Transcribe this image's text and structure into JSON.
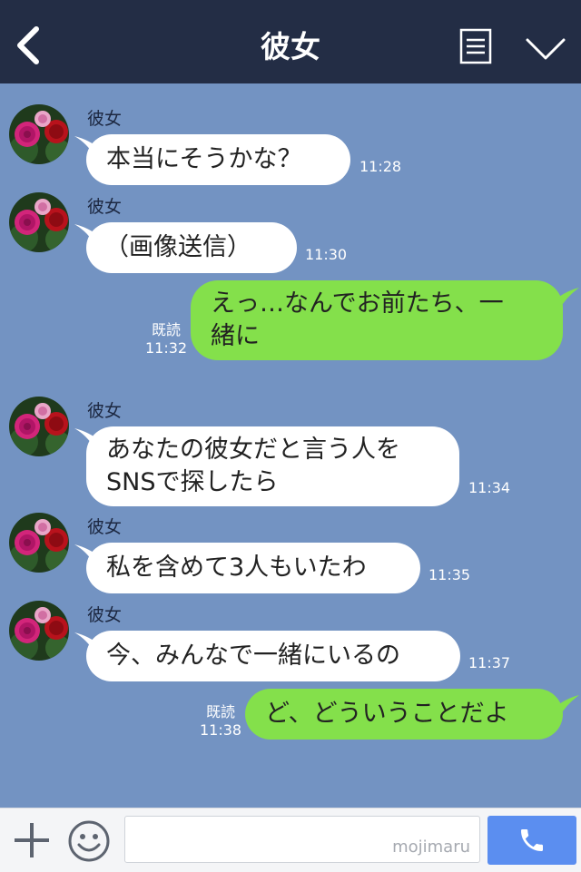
{
  "header": {
    "title": "彼女"
  },
  "messages": [
    {
      "side": "left",
      "name": "彼女",
      "text": "本当にそうかな？",
      "time": "11:28"
    },
    {
      "side": "left",
      "name": "彼女",
      "text": "（画像送信）",
      "time": "11:30"
    },
    {
      "side": "right",
      "read": "既読",
      "text_line1": "えっ…なんでお前たち、一",
      "text_line2": "緒に",
      "time": "11:32"
    },
    {
      "side": "left",
      "name": "彼女",
      "text_line1": "あなたの彼女だと言う人を",
      "text_line2": "SNSで探したら",
      "time": "11:34"
    },
    {
      "side": "left",
      "name": "彼女",
      "text": "私を含めて3人もいたわ",
      "time": "11:35"
    },
    {
      "side": "left",
      "name": "彼女",
      "text": "今、みんなで一緒にいるの",
      "time": "11:37"
    },
    {
      "side": "right",
      "read": "既読",
      "text": "ど、どういうことだよ",
      "time": "11:38"
    }
  ],
  "footer": {
    "input_value": "",
    "watermark": "mojimaru"
  },
  "colors": {
    "header": "#232d45",
    "chat_bg": "#7393c2",
    "sent_bubble": "#84e04b",
    "received_bubble": "#ffffff",
    "send_button": "#5b8ef0"
  },
  "icons": [
    "back-icon",
    "menu-icon",
    "chevron-down-icon",
    "plus-icon",
    "smile-icon",
    "phone-icon"
  ]
}
